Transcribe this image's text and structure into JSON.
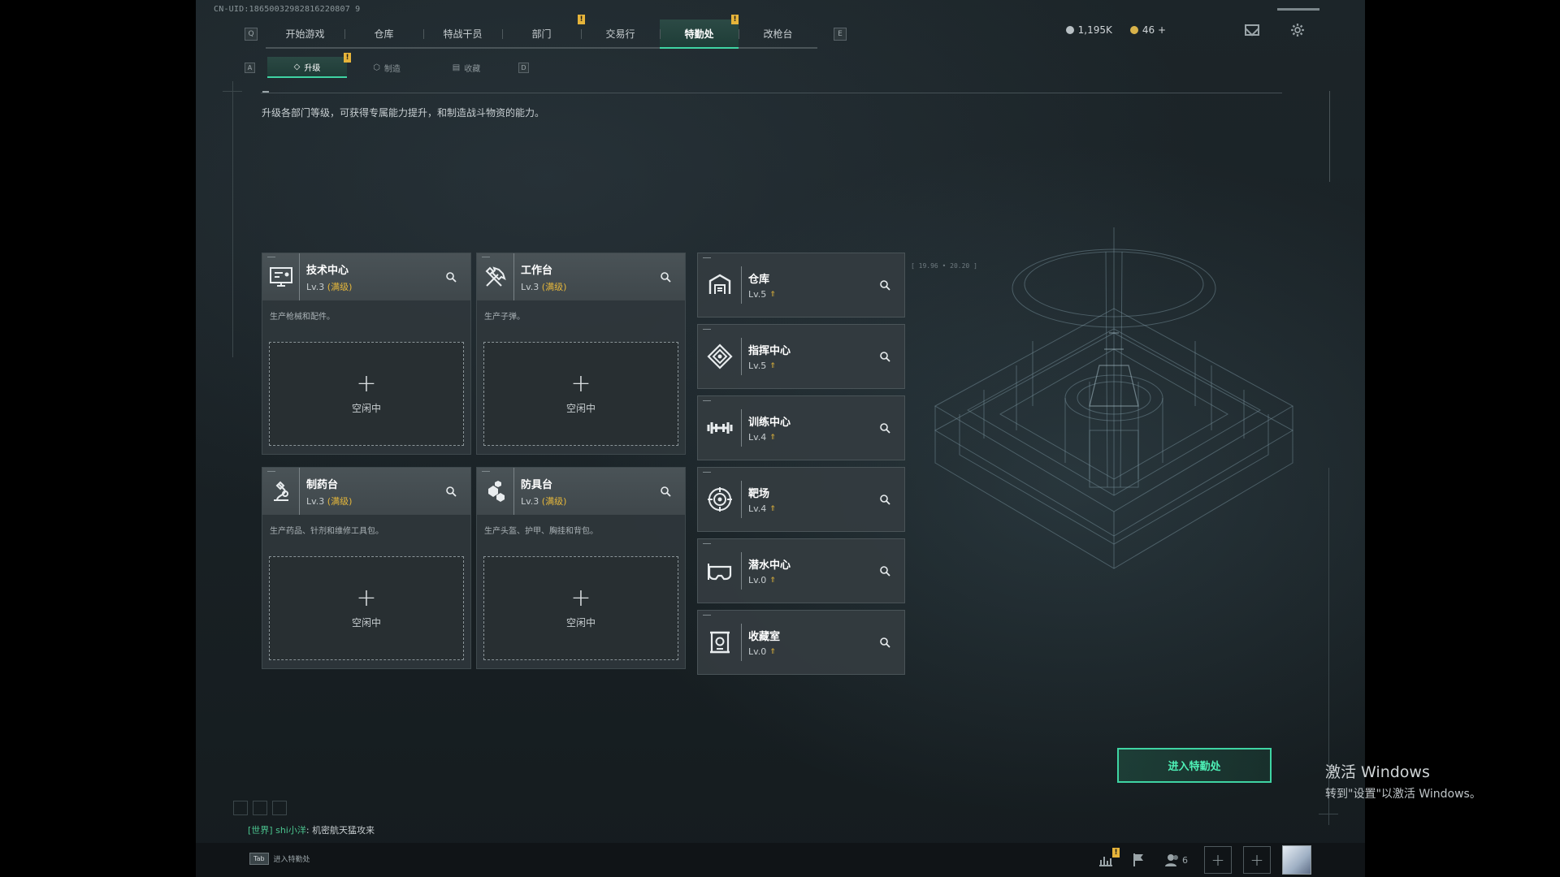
{
  "header": {
    "uid": "CN-UID:18650032982816220807 9",
    "left_key": "Q",
    "right_key": "E",
    "tabs": [
      {
        "label": "开始游戏",
        "active": false,
        "badge": ""
      },
      {
        "label": "仓库",
        "active": false,
        "badge": ""
      },
      {
        "label": "特战干员",
        "active": false,
        "badge": ""
      },
      {
        "label": "部门",
        "active": false,
        "badge": "!"
      },
      {
        "label": "交易行",
        "active": false,
        "badge": ""
      },
      {
        "label": "特勤处",
        "active": true,
        "badge": "!"
      },
      {
        "label": "改枪台",
        "active": false,
        "badge": ""
      }
    ],
    "currency": [
      {
        "icon": "silver-coin-icon",
        "value": "1,195K",
        "color": "#b8c0c4"
      },
      {
        "icon": "gold-coin-icon",
        "value": "46 +",
        "color": "#d8b24a"
      }
    ]
  },
  "subnav": {
    "left_key": "A",
    "right_key": "D",
    "tabs": [
      {
        "label": "升级",
        "active": true,
        "badge": "!"
      },
      {
        "label": "制造",
        "active": false,
        "badge": ""
      },
      {
        "label": "收藏",
        "active": false,
        "badge": ""
      }
    ]
  },
  "description": "升级各部门等级，可获得专属能力提升，和制造战斗物资的能力。",
  "production_cards": [
    {
      "name": "技术中心",
      "level": "Lv.3",
      "status": "(满级)",
      "desc": "生产枪械和配件。",
      "slot_text": "空闲中",
      "icon": "tech-center-icon"
    },
    {
      "name": "工作台",
      "level": "Lv.3",
      "status": "(满级)",
      "desc": "生产子弹。",
      "slot_text": "空闲中",
      "icon": "workbench-icon"
    },
    {
      "name": "制药台",
      "level": "Lv.3",
      "status": "(满级)",
      "desc": "生产药品、针剂和维修工具包。",
      "slot_text": "空闲中",
      "icon": "pharmacy-icon"
    },
    {
      "name": "防具台",
      "level": "Lv.3",
      "status": "(满级)",
      "desc": "生产头盔、护甲、胸挂和背包。",
      "slot_text": "空闲中",
      "icon": "armor-bench-icon"
    }
  ],
  "departments": [
    {
      "name": "仓库",
      "level": "Lv.5",
      "icon": "warehouse-icon"
    },
    {
      "name": "指挥中心",
      "level": "Lv.5",
      "icon": "command-center-icon"
    },
    {
      "name": "训练中心",
      "level": "Lv.4",
      "icon": "training-center-icon"
    },
    {
      "name": "靶场",
      "level": "Lv.4",
      "icon": "shooting-range-icon"
    },
    {
      "name": "潜水中心",
      "level": "Lv.0",
      "icon": "diving-center-icon"
    },
    {
      "name": "收藏室",
      "level": "Lv.0",
      "icon": "collection-room-icon"
    }
  ],
  "base_coord": "[ 19.96 • 20.20 ]",
  "enter_button": "进入特勤处",
  "chat": {
    "channel": "[世界]",
    "user": "shi小洋",
    "message": "机密航天猛攻来"
  },
  "bottom": {
    "tab_key": "Tab",
    "tab_label": "进入特勤处",
    "friends_count": "6",
    "stats_badge": "!"
  },
  "watermark": {
    "line1": "激活 Windows",
    "line2": "转到\"设置\"以激活 Windows。"
  },
  "colors": {
    "accent": "#3fd4a3",
    "warning": "#e5b73b",
    "panel": "#3f474b"
  }
}
